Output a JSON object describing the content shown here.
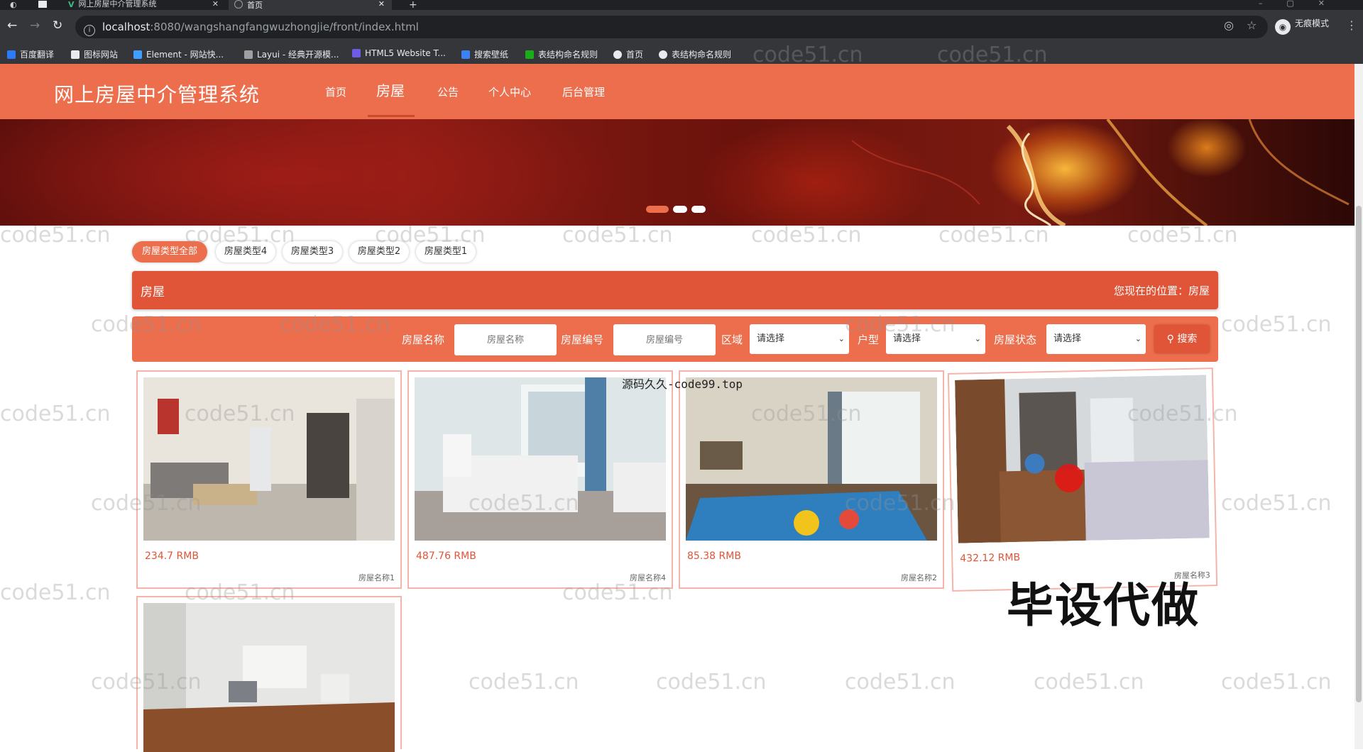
{
  "browser": {
    "tabs": [
      {
        "title": "网上房屋中介管理系统"
      },
      {
        "title": "首页"
      }
    ],
    "url_host": "localhost",
    "url_rest": ":8080/wangshangfangwuzhongjie/front/index.html",
    "incognito_label": "无痕模式",
    "bookmarks": [
      "百度翻译",
      "图标网站",
      "Element - 网站快...",
      "Layui - 经典开源模...",
      "HTML5 Website T...",
      "搜索壁纸",
      "表结构命名规则",
      "首页",
      "表结构命名规则"
    ]
  },
  "header": {
    "logo": "网上房屋中介管理系统",
    "menu": [
      "首页",
      "房屋",
      "公告",
      "个人中心",
      "后台管理"
    ],
    "active_index": 1
  },
  "type_tabs": [
    "房屋类型全部",
    "房屋类型4",
    "房屋类型3",
    "房屋类型2",
    "房屋类型1"
  ],
  "title_bar": {
    "title": "房屋",
    "location": "您现在的位置：房屋"
  },
  "search": {
    "name_label": "房屋名称",
    "name_placeholder": "房屋名称",
    "code_label": "房屋编号",
    "code_placeholder": "房屋编号",
    "area_label": "区域",
    "area_value": "请选择",
    "layout_label": "户型",
    "layout_value": "请选择",
    "status_label": "房屋状态",
    "status_value": "请选择",
    "button": "搜索"
  },
  "houses": [
    {
      "price": "234.7 RMB",
      "name": "房屋名称1"
    },
    {
      "price": "487.76 RMB",
      "name": "房屋名称4"
    },
    {
      "price": "85.38 RMB",
      "name": "房屋名称2"
    },
    {
      "price": "432.12 RMB",
      "name": "房屋名称3"
    }
  ],
  "overlays": {
    "code_text": "源码久久-code99.top",
    "big_text": "毕设代做",
    "watermark": "code51.cn"
  }
}
